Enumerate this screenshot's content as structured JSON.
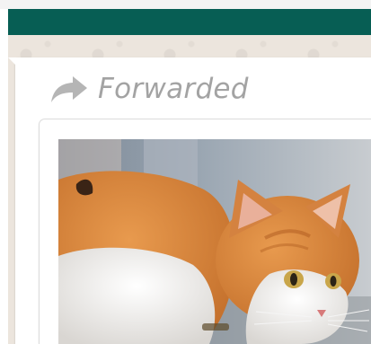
{
  "message": {
    "forwarded_label": "Forwarded",
    "forward_icon": "forward-arrow-icon",
    "media_kind": "photo"
  },
  "colors": {
    "header": "#075e54",
    "chat_background": "#ece5dd",
    "bubble": "#ffffff",
    "forwarded_text": "#a3a3a3"
  }
}
